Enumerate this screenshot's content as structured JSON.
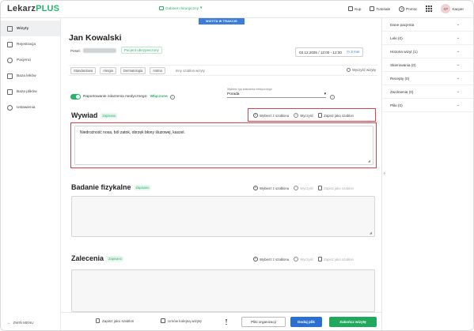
{
  "app": {
    "logo_main": "Lekarz",
    "logo_accent": "PLUS",
    "cabinet": "Gabinet chirurgiczny"
  },
  "topbar": {
    "shop": "Kup",
    "tutorials": "Tutoriale",
    "help": "Pomoc",
    "avatar_initials": "KP",
    "user": "Kacper"
  },
  "sidebar": {
    "items": [
      {
        "label": "Wizyty",
        "icon": "calendar-icon"
      },
      {
        "label": "Rejestracja",
        "icon": "clipboard-icon"
      },
      {
        "label": "Pacjenci",
        "icon": "users-icon"
      },
      {
        "label": "Baza leków",
        "icon": "pill-icon"
      },
      {
        "label": "Baza plików",
        "icon": "folder-icon"
      },
      {
        "label": "Ustawienia",
        "icon": "gear-icon"
      }
    ],
    "collapse_label": "ZWIŃ MENU"
  },
  "visit": {
    "status": "WIZYTA W TRAKCIE",
    "patient_name": "Jan Kowalski",
    "pesel_label": "Pesel:",
    "insured": "Pacjent ubezpieczony",
    "date_time": "03.12.2025 / 12:00 - 12:30",
    "duration": "3 min"
  },
  "templates": {
    "chips": [
      "Standardowa",
      "Alergia",
      "Dermatologia",
      "Astma"
    ],
    "other": "Inny szablon wizyty",
    "clear": "Wyczyść wizytę"
  },
  "medical_event": {
    "toggle_label": "Raportowanie zdarzenia medycznego:",
    "toggle_state": "Włączone",
    "type_label": "Wybierz typ zdarzenia medycznego",
    "type_value": "Porada"
  },
  "sections": {
    "actions": {
      "choose_template": "Wybierz z szablonu",
      "clear": "Wyczyść",
      "save_template": "Zapisz jako szablon"
    },
    "interview": {
      "title": "Wywiad",
      "badge": "Zapisano",
      "text": "Niedrożność nosa, ból zatok, obrzęk błony śluzowej, kaszel."
    },
    "exam": {
      "title": "Badanie fizykalne",
      "badge": "Zapisano",
      "text": ""
    },
    "recommendations": {
      "title": "Zalecenia",
      "badge": "Zapisano",
      "text": ""
    }
  },
  "bottombar": {
    "save_template": "Zapisz jako szablon",
    "next_visit": "Umów kolejną wizytę",
    "files_org": "Pliki organizacji",
    "add_file": "Dodaj plik",
    "finish": "Zakończ wizytę"
  },
  "right_panel": {
    "items": [
      "Dane pacjenta",
      "Leki  (0)",
      "Historia wizyt (1)",
      "Skierowania (0)",
      "Recepty (0)",
      "Zwolnienia (0)",
      "Pliki  (0)"
    ]
  },
  "colors": {
    "brand_green": "#27b36b",
    "accent_blue": "#2b6fd2",
    "highlight_red": "#e0404a"
  }
}
